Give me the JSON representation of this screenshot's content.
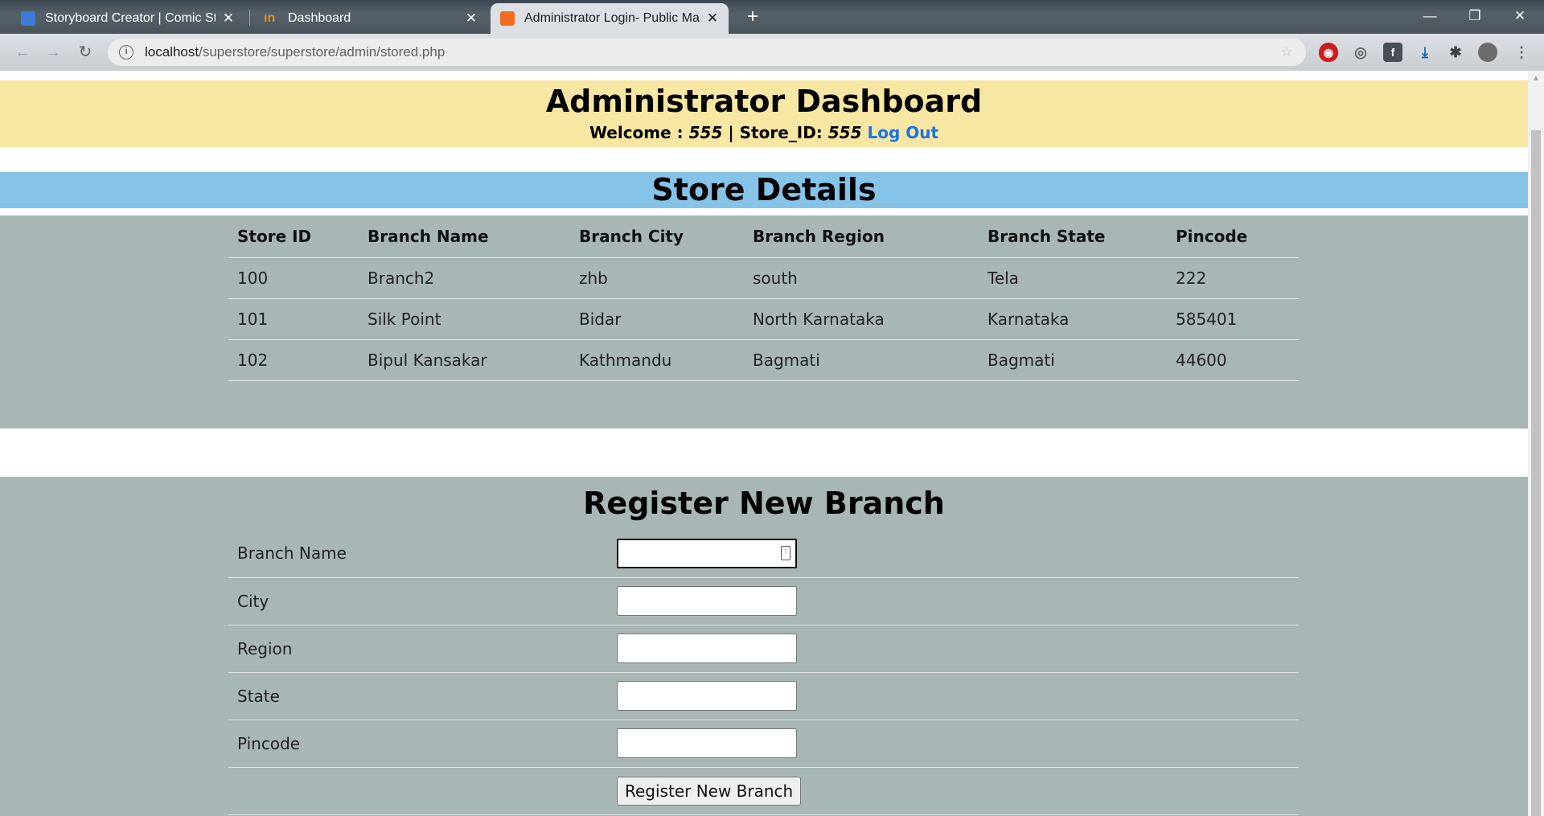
{
  "browser": {
    "tabs": [
      {
        "title": "Storyboard Creator | Comic Strip",
        "favicon_color": "#3d7bd8"
      },
      {
        "title": "Dashboard",
        "favicon_color": "#f08a1c"
      },
      {
        "title": "Administrator Login- Public Mart",
        "favicon_color": "#f26d21"
      }
    ],
    "url_host": "localhost",
    "url_path": "/superstore/superstore/admin/stored.php"
  },
  "header": {
    "title": "Administrator Dashboard",
    "welcome_label": "Welcome : ",
    "user": "555",
    "separator": " | Store_ID: ",
    "store_id": "555",
    "logout": "Log Out"
  },
  "store_details": {
    "title": "Store Details",
    "columns": [
      "Store ID",
      "Branch Name",
      "Branch City",
      "Branch Region",
      "Branch State",
      "Pincode"
    ],
    "rows": [
      [
        "100",
        "Branch2",
        "zhb",
        "south",
        "Tela",
        "222"
      ],
      [
        "101",
        "Silk Point",
        "Bidar",
        "North Karnataka",
        "Karnataka",
        "585401"
      ],
      [
        "102",
        "Bipul Kansakar",
        "Kathmandu",
        "Bagmati",
        "Bagmati",
        "44600"
      ]
    ]
  },
  "register": {
    "title": "Register New Branch",
    "fields": [
      {
        "label": "Branch Name",
        "value": ""
      },
      {
        "label": "City",
        "value": ""
      },
      {
        "label": "Region",
        "value": ""
      },
      {
        "label": "State",
        "value": ""
      },
      {
        "label": "Pincode",
        "value": ""
      }
    ],
    "submit_label": "Register New Branch"
  }
}
